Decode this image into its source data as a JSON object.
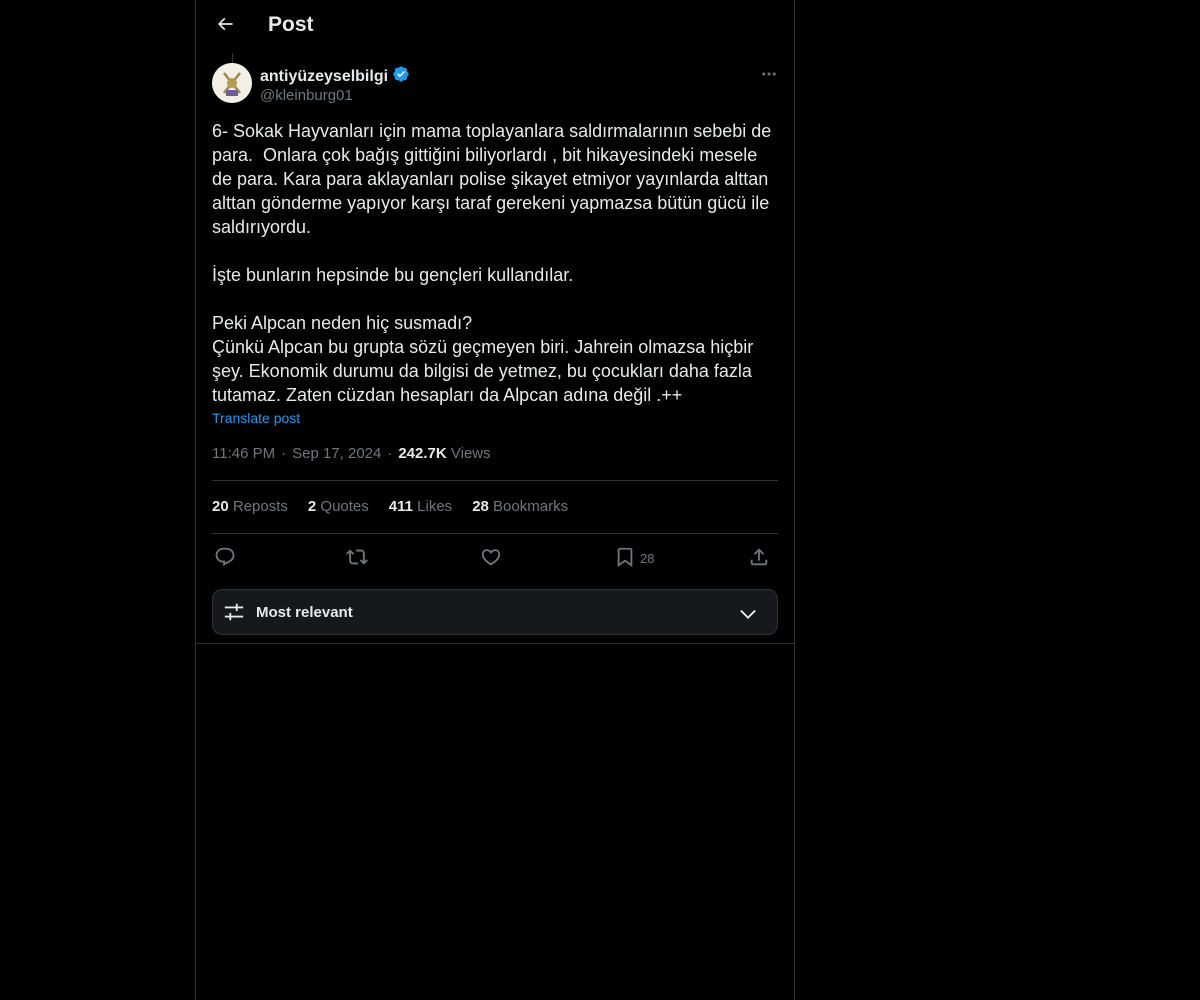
{
  "header": {
    "title": "Post",
    "back_icon": "arrow-left-icon"
  },
  "author": {
    "name": "antiyüzeyselbilgi",
    "handle": "@kleinburg01",
    "verified_color": "#1d9bf0"
  },
  "post": {
    "body": "6- Sokak Hayvanları için mama toplayanlara saldırmalarının sebebi de\npara.  Onlara çok bağış gittiğini biliyorlardı , bit hikayesindeki mesele\nde para. Kara para aklayanları polise şikayet etmiyor yayınlarda alttan\nalttan gönderme yapıyor karşı taraf gerekeni yapmazsa bütün gücü ile\nsaldırıyordu.\n\nİşte bunların hepsinde bu gençleri kullandılar.\n\nPeki Alpcan neden hiç susmadı?\nÇünkü Alpcan bu grupta sözü geçmeyen biri. Jahrein olmazsa hiçbir\nşey. Ekonomik durumu da bilgisi de yetmez, bu çocukları daha fazla\ntutamaz. Zaten cüzdan hesapları da Alpcan adına değil .++",
    "translate_label": "Translate post",
    "time": "11:46 PM",
    "separator": "·",
    "date": "Sep 17, 2024",
    "views_count": "242.7K",
    "views_label": "Views"
  },
  "stats": {
    "reposts_count": "20",
    "reposts_label": "Reposts",
    "quotes_count": "2",
    "quotes_label": "Quotes",
    "likes_count": "411",
    "likes_label": "Likes",
    "bookmarks_count": "28",
    "bookmarks_label": "Bookmarks"
  },
  "actions": {
    "bookmark_count": "28"
  },
  "sort": {
    "label": "Most relevant"
  },
  "colors": {
    "background": "#000000",
    "text": "#e7e9ea",
    "muted": "#71767b",
    "accent": "#1d9bf0",
    "border": "#2f3336"
  }
}
